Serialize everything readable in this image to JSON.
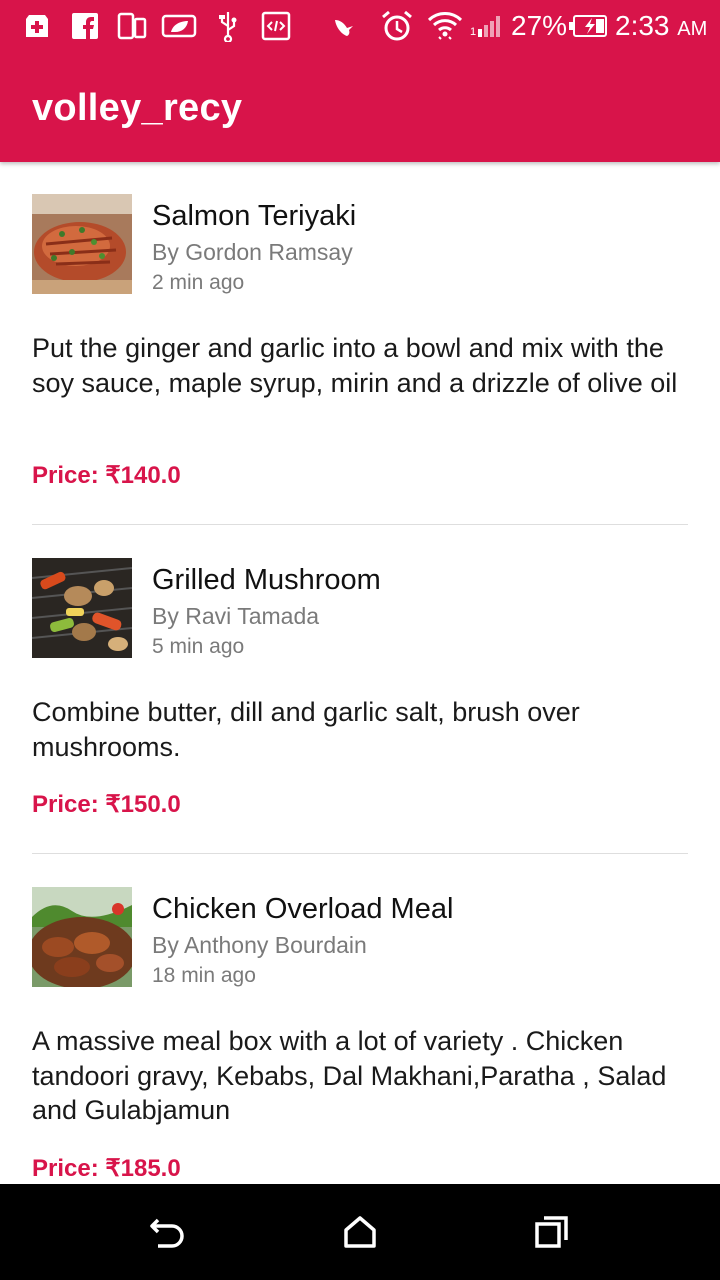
{
  "status_bar": {
    "battery_percent": "27%",
    "time": "2:33",
    "ampm": "AM",
    "icons": [
      "medical-plus-icon",
      "facebook-icon",
      "phone-tablet-icon",
      "leaf-icon",
      "usb-icon",
      "code-icon",
      "bird-icon",
      "alarm-icon",
      "wifi-icon",
      "signal-icon",
      "battery-charging-icon"
    ]
  },
  "toolbar": {
    "title": "volley_recy"
  },
  "accent_color": "#d8144a",
  "recipes": [
    {
      "title": "Salmon Teriyaki",
      "author": "By Gordon Ramsay",
      "time": "2 min ago",
      "description": "Put the ginger and garlic into a bowl and mix with the soy sauce, maple syrup, mirin and a drizzle of olive oil",
      "price": "Price: ₹140.0"
    },
    {
      "title": "Grilled Mushroom",
      "author": "By Ravi Tamada",
      "time": "5 min ago",
      "description": "Combine butter, dill and garlic salt, brush over mushrooms.",
      "price": "Price: ₹150.0"
    },
    {
      "title": "Chicken Overload Meal",
      "author": "By Anthony Bourdain",
      "time": "18 min ago",
      "description": "A massive meal box with a lot of variety . Chicken tandoori gravy, Kebabs, Dal Makhani,Paratha , Salad and Gulabjamun",
      "price": "Price: ₹185.0"
    }
  ],
  "nav_bar": {
    "icons": [
      "back-icon",
      "home-icon",
      "recents-icon"
    ]
  }
}
